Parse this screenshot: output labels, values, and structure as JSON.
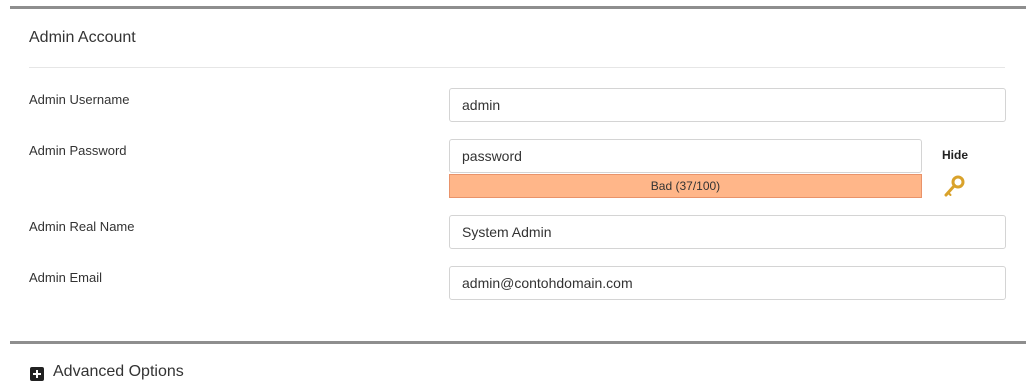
{
  "admin_account": {
    "title": "Admin Account",
    "username": {
      "label": "Admin Username",
      "value": "admin"
    },
    "password": {
      "label": "Admin Password",
      "value": "password",
      "strength_text": "Bad (37/100)",
      "strength_score": 37,
      "toggle_label": "Hide"
    },
    "real_name": {
      "label": "Admin Real Name",
      "value": "System Admin"
    },
    "email": {
      "label": "Admin Email",
      "value": "admin@contohdomain.com"
    }
  },
  "advanced": {
    "label": "Advanced Options"
  },
  "colors": {
    "strength_bar": "#ffb689",
    "panel_border": "#8e8e8e",
    "key_icon": "#e0a82e"
  },
  "icons": {
    "password_generator": "key-icon",
    "expand": "plus-square-icon"
  }
}
